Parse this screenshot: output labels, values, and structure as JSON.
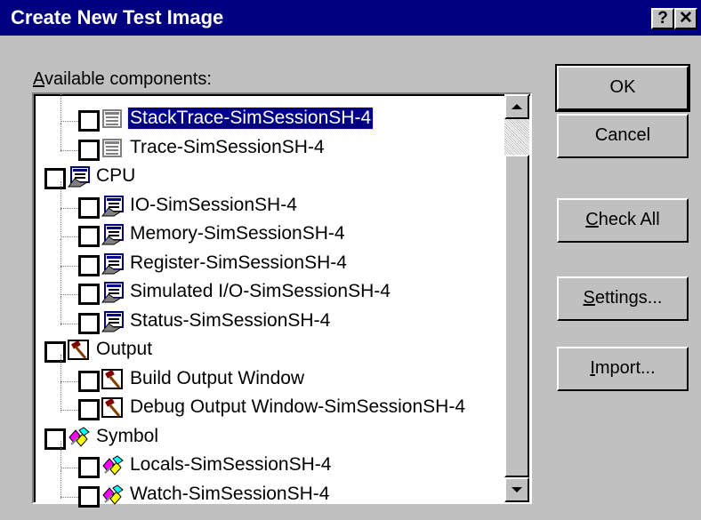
{
  "window": {
    "title": "Create New Test Image",
    "help_glyph": "?",
    "close_glyph": "✕"
  },
  "list": {
    "label_accel": "A",
    "label_rest": "vailable components:",
    "items": [
      {
        "label": "StackTrace-SimSessionSH-4",
        "level": 1,
        "icon": "trace-icon",
        "selected": true
      },
      {
        "label": "Trace-SimSessionSH-4",
        "level": 1,
        "icon": "trace-icon"
      },
      {
        "label": "CPU",
        "level": 0,
        "icon": "cpu-icon"
      },
      {
        "label": "IO-SimSessionSH-4",
        "level": 1,
        "icon": "cpu-icon"
      },
      {
        "label": "Memory-SimSessionSH-4",
        "level": 1,
        "icon": "cpu-icon"
      },
      {
        "label": "Register-SimSessionSH-4",
        "level": 1,
        "icon": "cpu-icon"
      },
      {
        "label": "Simulated I/O-SimSessionSH-4",
        "level": 1,
        "icon": "cpu-icon"
      },
      {
        "label": "Status-SimSessionSH-4",
        "level": 1,
        "icon": "cpu-icon"
      },
      {
        "label": "Output",
        "level": 0,
        "icon": "hammer-icon"
      },
      {
        "label": "Build Output Window",
        "level": 1,
        "icon": "hammer-icon"
      },
      {
        "label": "Debug Output Window-SimSessionSH-4",
        "level": 1,
        "icon": "hammer-icon"
      },
      {
        "label": "Symbol",
        "level": 0,
        "icon": "symbol-icon"
      },
      {
        "label": "Locals-SimSessionSH-4",
        "level": 1,
        "icon": "symbol-icon"
      },
      {
        "label": "Watch-SimSessionSH-4",
        "level": 1,
        "icon": "symbol-icon"
      }
    ]
  },
  "buttons": {
    "ok": "OK",
    "cancel": "Cancel",
    "check_all_accel": "C",
    "check_all_rest": "heck All",
    "settings_accel": "S",
    "settings_rest": "ettings...",
    "import_accel": "I",
    "import_rest": "mport..."
  },
  "scroll": {
    "position": 0.0,
    "visible_fraction": 0.9
  }
}
